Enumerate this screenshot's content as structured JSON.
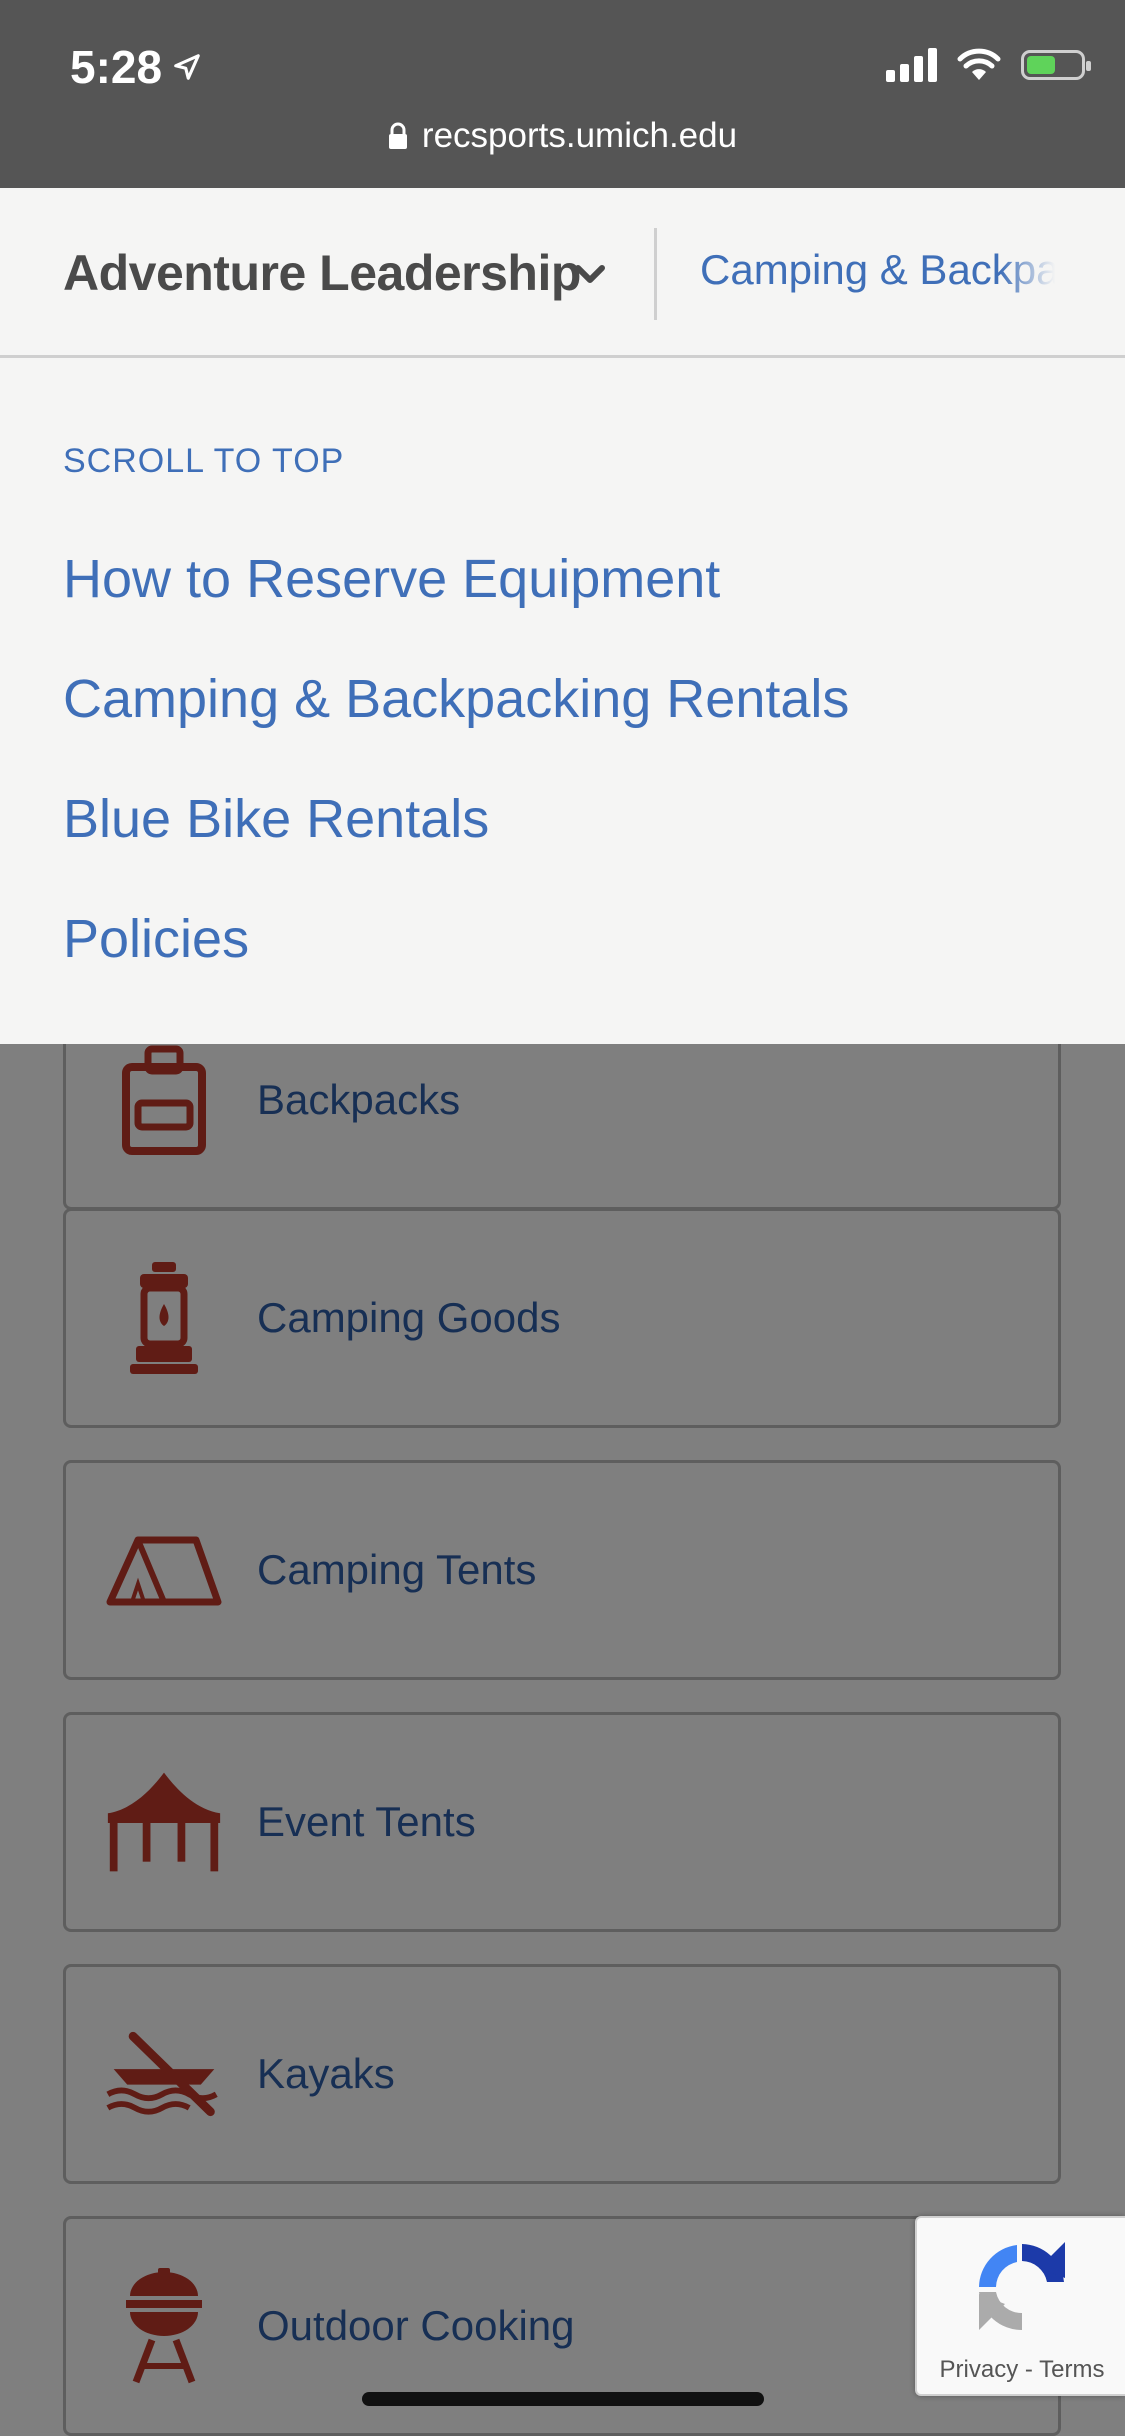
{
  "status_bar": {
    "time": "5:28",
    "url": "recsports.umich.edu"
  },
  "subnav": {
    "title": "Adventure Leadership",
    "link": "Camping & Backpacking Rentals"
  },
  "dropdown": {
    "scroll_to_top": "SCROLL TO TOP",
    "items": [
      "How to Reserve Equipment",
      "Camping & Backpacking Rentals",
      "Blue Bike Rentals",
      "Policies"
    ]
  },
  "cards": [
    {
      "label": "Backpacks",
      "icon": "backpack-icon"
    },
    {
      "label": "Camping Goods",
      "icon": "lantern-icon"
    },
    {
      "label": "Camping Tents",
      "icon": "tent-icon"
    },
    {
      "label": "Event Tents",
      "icon": "canopy-tent-icon"
    },
    {
      "label": "Kayaks",
      "icon": "kayak-icon"
    },
    {
      "label": "Outdoor Cooking",
      "icon": "grill-icon"
    }
  ],
  "recaptcha": {
    "privacy": "Privacy",
    "separator": "-",
    "terms": "Terms"
  },
  "colors": {
    "link": "#3f6fb8",
    "icon": "#c0392b",
    "status_bar": "#555555"
  }
}
